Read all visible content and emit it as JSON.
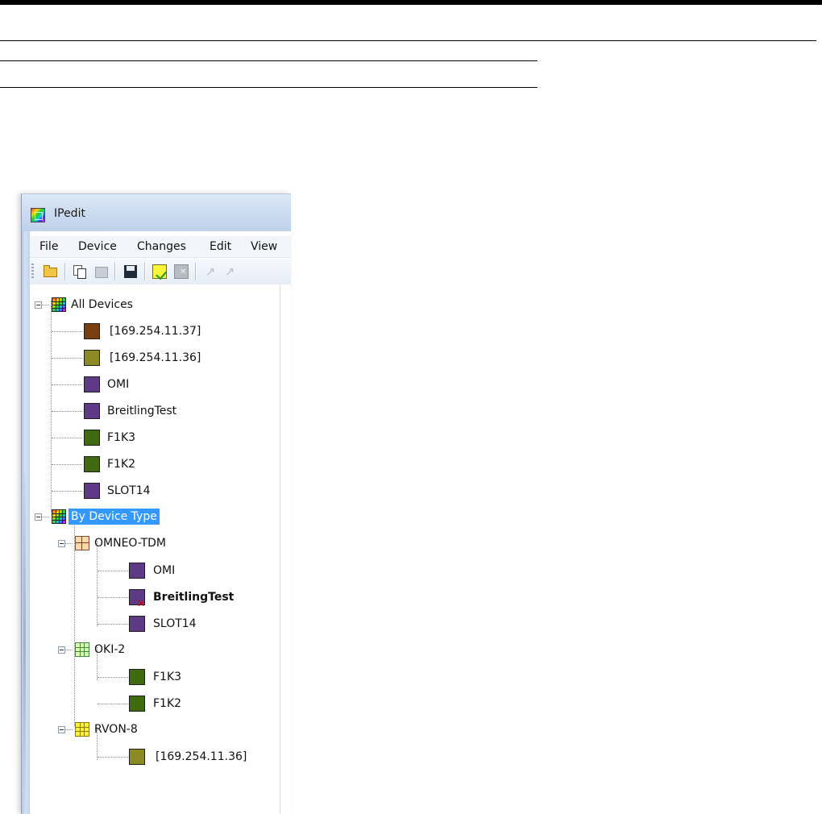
{
  "window": {
    "title": "IPedit"
  },
  "menu": {
    "file": "File",
    "device": "Device",
    "changes": "Changes",
    "edit": "Edit",
    "view": "View"
  },
  "colors": {
    "brown": "#7a3f10",
    "olive": "#8c8a25",
    "purple": "#5e3a86",
    "green": "#3f6a12",
    "selection": "#3399ff",
    "error": "#e00000"
  },
  "tree": {
    "all_devices": {
      "label": "All Devices",
      "children": [
        "[169.254.11.37]",
        "[169.254.11.36]",
        "OMI",
        "BreitlingTest",
        "F1K3",
        "F1K2",
        "SLOT14"
      ]
    },
    "by_device_type": {
      "label": "By Device Type",
      "selected": true,
      "groups": [
        {
          "label": "OMNEO-TDM",
          "children": [
            "OMI",
            "BreitlingTest",
            "SLOT14"
          ]
        },
        {
          "label": "OKI-2",
          "children": [
            "F1K3",
            "F1K2"
          ]
        },
        {
          "label": "RVON-8",
          "children": [
            "[169.254.11.36]"
          ]
        }
      ]
    }
  }
}
